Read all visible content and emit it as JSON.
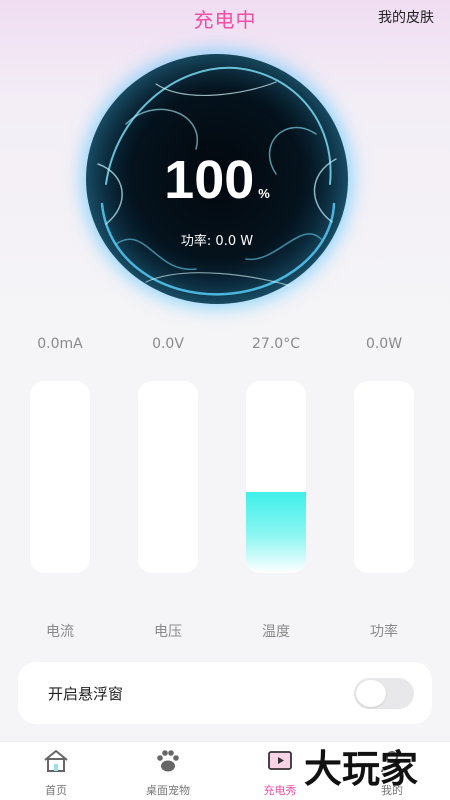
{
  "header": {
    "title": "充电中",
    "skin_label": "我的皮肤"
  },
  "battery": {
    "percent": "100",
    "percent_unit": "%",
    "power_line": "功率: 0.0 W"
  },
  "metrics": [
    {
      "value": "0.0mA",
      "label": "电流",
      "level": 0
    },
    {
      "value": "0.0V",
      "label": "电压",
      "level": 0
    },
    {
      "value": "27.0°C",
      "label": "温度",
      "level": 0.42
    },
    {
      "value": "0.0W",
      "label": "功率",
      "level": 0
    }
  ],
  "float_window": {
    "label": "开启悬浮窗",
    "enabled": false
  },
  "tabs": [
    {
      "label": "首页",
      "icon": "home-icon",
      "active": false
    },
    {
      "label": "桌面宠物",
      "icon": "paw-icon",
      "active": false
    },
    {
      "label": "充电秀",
      "icon": "play-screen-icon",
      "active": true
    },
    {
      "label": "我的",
      "icon": "person-icon",
      "active": false
    }
  ],
  "watermark": {
    "text": "大玩家"
  },
  "colors": {
    "accent": "#f04fa3",
    "fill": "#3ef0e8",
    "orb_glow": "#2ec6f0"
  }
}
